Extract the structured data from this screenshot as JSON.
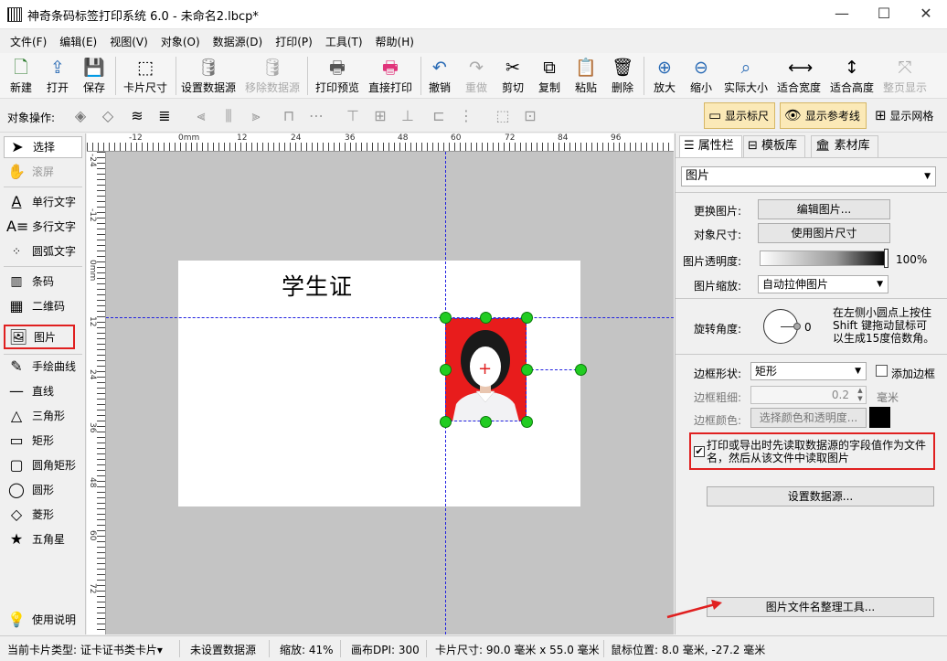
{
  "window": {
    "title": "神奇条码标签打印系统 6.0 - 未命名2.lbcp*",
    "minimize": "—",
    "maximize": "☐",
    "close": "✕"
  },
  "menu": [
    "文件(F)",
    "编辑(E)",
    "视图(V)",
    "对象(O)",
    "数据源(D)",
    "打印(P)",
    "工具(T)",
    "帮助(H)"
  ],
  "toolbar": {
    "new": "新建",
    "open": "打开",
    "save": "保存",
    "card_size": "卡片尺寸",
    "set_datasource": "设置数据源",
    "remove_datasource": "移除数据源",
    "print_preview": "打印预览",
    "direct_print": "直接打印",
    "undo": "撤销",
    "redo": "重做",
    "cut": "剪切",
    "copy": "复制",
    "paste": "粘贴",
    "delete": "删除",
    "zoom_in": "放大",
    "zoom_out": "缩小",
    "actual_size": "实际大小",
    "fit_width": "适合宽度",
    "fit_height": "适合高度",
    "full_page": "整页显示"
  },
  "objbar": {
    "label": "对象操作:",
    "show_ruler": "显示标尺",
    "show_guides": "显示参考线",
    "show_grid": "显示网格"
  },
  "tools": {
    "select": "选择",
    "scroll": "滚屏",
    "single_text": "单行文字",
    "multi_text": "多行文字",
    "arc_text": "圆弧文字",
    "barcode": "条码",
    "qrcode": "二维码",
    "image": "图片",
    "freehand": "手绘曲线",
    "line": "直线",
    "triangle": "三角形",
    "rectangle": "矩形",
    "rounded_rect": "圆角矩形",
    "ellipse": "圆形",
    "diamond": "菱形",
    "star": "五角星",
    "help": "使用说明"
  },
  "ruler": {
    "top": [
      "-12",
      "0mm",
      "12",
      "24",
      "36",
      "48",
      "60",
      "72",
      "84",
      "96"
    ],
    "left": [
      "-24",
      "-12",
      "0mm",
      "12",
      "24",
      "36",
      "48",
      "60",
      "72"
    ]
  },
  "card": {
    "title": "学生证"
  },
  "panel": {
    "tabs": [
      "属性栏",
      "模板库",
      "素材库"
    ],
    "object_type": "图片",
    "change_image_label": "更换图片:",
    "edit_image_button": "编辑图片...",
    "object_size_label": "对象尺寸:",
    "use_image_size_button": "使用图片尺寸",
    "opacity_label": "图片透明度:",
    "opacity_value": "100%",
    "scale_label": "图片缩放:",
    "scale_value": "自动拉伸图片",
    "rotate_label": "旋转角度:",
    "rotate_value": "0",
    "rotate_hint": "在左侧小圆点上按住 Shift 键拖动鼠标可以生成15度倍数角。",
    "border_shape_label": "边框形状:",
    "border_shape_value": "矩形",
    "add_border_label": "添加边框",
    "border_width_label": "边框粗细:",
    "border_width_value": "0.2",
    "border_width_unit": "毫米",
    "border_color_label": "边框颜色:",
    "border_color_button": "选择颜色和透明度...",
    "datasource_filename_checkbox": "打印或导出时先读取数据源的字段值作为文件名，然后从该文件中读取图片",
    "set_datasource_button": "设置数据源...",
    "filename_tool_button": "图片文件名整理工具..."
  },
  "status": {
    "card_type": "当前卡片类型: 证卡证书类卡片▾",
    "datasource": "未设置数据源",
    "zoom": "缩放: 41%",
    "dpi": "画布DPI: 300",
    "card_size": "卡片尺寸: 90.0 毫米 x 55.0 毫米",
    "mouse_pos": "鼠标位置: 8.0 毫米, -27.2 毫米"
  },
  "colors": {
    "accent_red": "#e02020",
    "photo_bg": "#e81c1c",
    "handle": "#22cc22",
    "guide": "#0000ff"
  }
}
